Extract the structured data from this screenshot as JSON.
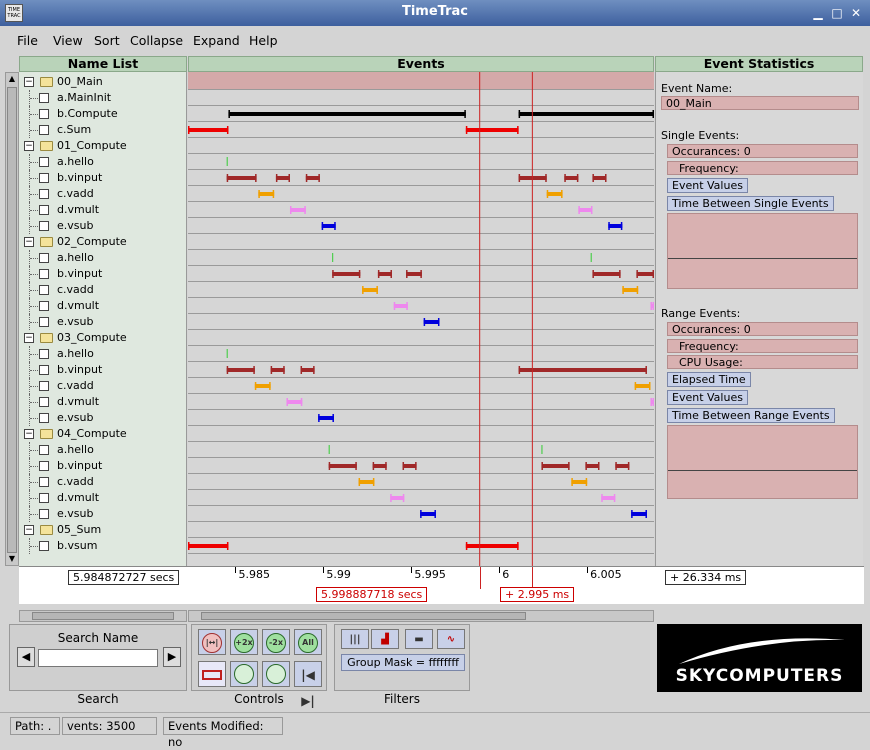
{
  "window": {
    "title": "TimeTrac",
    "logo_text": "TIME TRAC"
  },
  "menu": [
    "File",
    "View",
    "Sort",
    "Collapse",
    "Expand",
    "Help"
  ],
  "headers": {
    "names": "Name List",
    "events": "Events",
    "stats": "Event Statistics"
  },
  "tree": [
    {
      "label": "00_Main",
      "type": "group"
    },
    {
      "label": "a.MainInit",
      "type": "item"
    },
    {
      "label": "b.Compute",
      "type": "item"
    },
    {
      "label": "c.Sum",
      "type": "item"
    },
    {
      "label": "01_Compute",
      "type": "group"
    },
    {
      "label": "a.hello",
      "type": "item"
    },
    {
      "label": "b.vinput",
      "type": "item"
    },
    {
      "label": "c.vadd",
      "type": "item"
    },
    {
      "label": "d.vmult",
      "type": "item"
    },
    {
      "label": "e.vsub",
      "type": "item"
    },
    {
      "label": "02_Compute",
      "type": "group"
    },
    {
      "label": "a.hello",
      "type": "item"
    },
    {
      "label": "b.vinput",
      "type": "item"
    },
    {
      "label": "c.vadd",
      "type": "item"
    },
    {
      "label": "d.vmult",
      "type": "item"
    },
    {
      "label": "e.vsub",
      "type": "item"
    },
    {
      "label": "03_Compute",
      "type": "group"
    },
    {
      "label": "a.hello",
      "type": "item"
    },
    {
      "label": "b.vinput",
      "type": "item"
    },
    {
      "label": "c.vadd",
      "type": "item"
    },
    {
      "label": "d.vmult",
      "type": "item"
    },
    {
      "label": "e.vsub",
      "type": "item"
    },
    {
      "label": "04_Compute",
      "type": "group"
    },
    {
      "label": "a.hello",
      "type": "item"
    },
    {
      "label": "b.vinput",
      "type": "item"
    },
    {
      "label": "c.vadd",
      "type": "item"
    },
    {
      "label": "d.vmult",
      "type": "item"
    },
    {
      "label": "e.vsub",
      "type": "item"
    },
    {
      "label": "05_Sum",
      "type": "group"
    },
    {
      "label": "b.vsum",
      "type": "item"
    }
  ],
  "events": {
    "colors": {
      "compute": "#000000",
      "sum": "#ee0000",
      "hello": "#33cc33",
      "vinput": "#a02828",
      "vadd": "#f0a000",
      "vmult": "#ee88ee",
      "vsub": "#0000dd",
      "selection": "#cc2222",
      "header_band": "#d4a9a9"
    },
    "t_start": 5.9823,
    "t_end": 6.0088,
    "selection": [
      5.998887718,
      6.001882718
    ],
    "rows": [
      [],
      [],
      [
        {
          "s": 5.9846,
          "e": 5.9981,
          "c": "compute"
        },
        {
          "s": 6.0011,
          "e": 6.0088,
          "c": "compute"
        }
      ],
      [
        {
          "s": 5.9823,
          "e": 5.9846,
          "c": "sum"
        },
        {
          "s": 5.9981,
          "e": 6.0011,
          "c": "sum"
        }
      ],
      [],
      [
        {
          "s": 5.9845,
          "e": 5.9846,
          "c": "hello"
        }
      ],
      [
        {
          "s": 5.9845,
          "e": 5.9862,
          "c": "vinput"
        },
        {
          "s": 5.9873,
          "e": 5.9881,
          "c": "vinput"
        },
        {
          "s": 5.989,
          "e": 5.9898,
          "c": "vinput"
        },
        {
          "s": 6.0011,
          "e": 6.0027,
          "c": "vinput"
        },
        {
          "s": 6.0037,
          "e": 6.0045,
          "c": "vinput"
        },
        {
          "s": 6.0053,
          "e": 6.0061,
          "c": "vinput"
        }
      ],
      [
        {
          "s": 5.9863,
          "e": 5.9872,
          "c": "vadd"
        },
        {
          "s": 6.0027,
          "e": 6.0036,
          "c": "vadd"
        }
      ],
      [
        {
          "s": 5.9881,
          "e": 5.989,
          "c": "vmult"
        },
        {
          "s": 6.0045,
          "e": 6.0053,
          "c": "vmult"
        }
      ],
      [
        {
          "s": 5.9899,
          "e": 5.9907,
          "c": "vsub"
        },
        {
          "s": 6.0062,
          "e": 6.007,
          "c": "vsub"
        }
      ],
      [],
      [
        {
          "s": 5.9905,
          "e": 5.9906,
          "c": "hello"
        },
        {
          "s": 6.0052,
          "e": 6.0053,
          "c": "hello"
        }
      ],
      [
        {
          "s": 5.9905,
          "e": 5.9921,
          "c": "vinput"
        },
        {
          "s": 5.9931,
          "e": 5.9939,
          "c": "vinput"
        },
        {
          "s": 5.9947,
          "e": 5.9956,
          "c": "vinput"
        },
        {
          "s": 6.0053,
          "e": 6.0069,
          "c": "vinput"
        },
        {
          "s": 6.0078,
          "e": 6.0088,
          "c": "vinput"
        }
      ],
      [
        {
          "s": 5.9922,
          "e": 5.9931,
          "c": "vadd"
        },
        {
          "s": 6.007,
          "e": 6.0079,
          "c": "vadd"
        }
      ],
      [
        {
          "s": 5.994,
          "e": 5.9948,
          "c": "vmult"
        },
        {
          "s": 6.0086,
          "e": 6.0088,
          "c": "vmult"
        }
      ],
      [
        {
          "s": 5.9957,
          "e": 5.9966,
          "c": "vsub"
        }
      ],
      [],
      [
        {
          "s": 5.9845,
          "e": 5.9846,
          "c": "hello"
        }
      ],
      [
        {
          "s": 5.9845,
          "e": 5.9861,
          "c": "vinput"
        },
        {
          "s": 5.987,
          "e": 5.9878,
          "c": "vinput"
        },
        {
          "s": 5.9887,
          "e": 5.9895,
          "c": "vinput"
        },
        {
          "s": 6.0011,
          "e": 6.0084,
          "c": "vinput"
        }
      ],
      [
        {
          "s": 5.9861,
          "e": 5.987,
          "c": "vadd"
        },
        {
          "s": 6.0077,
          "e": 6.0086,
          "c": "vadd"
        }
      ],
      [
        {
          "s": 5.9879,
          "e": 5.9888,
          "c": "vmult"
        },
        {
          "s": 6.0086,
          "e": 6.0088,
          "c": "vmult"
        }
      ],
      [
        {
          "s": 5.9897,
          "e": 5.9906,
          "c": "vsub"
        }
      ],
      [],
      [
        {
          "s": 5.9903,
          "e": 5.9904,
          "c": "hello"
        },
        {
          "s": 6.0024,
          "e": 6.0025,
          "c": "hello"
        }
      ],
      [
        {
          "s": 5.9903,
          "e": 5.9919,
          "c": "vinput"
        },
        {
          "s": 5.9928,
          "e": 5.9936,
          "c": "vinput"
        },
        {
          "s": 5.9945,
          "e": 5.9953,
          "c": "vinput"
        },
        {
          "s": 6.0024,
          "e": 6.004,
          "c": "vinput"
        },
        {
          "s": 6.0049,
          "e": 6.0057,
          "c": "vinput"
        },
        {
          "s": 6.0066,
          "e": 6.0074,
          "c": "vinput"
        }
      ],
      [
        {
          "s": 5.992,
          "e": 5.9929,
          "c": "vadd"
        },
        {
          "s": 6.0041,
          "e": 6.005,
          "c": "vadd"
        }
      ],
      [
        {
          "s": 5.9938,
          "e": 5.9946,
          "c": "vmult"
        },
        {
          "s": 6.0058,
          "e": 6.0066,
          "c": "vmult"
        }
      ],
      [
        {
          "s": 5.9955,
          "e": 5.9964,
          "c": "vsub"
        },
        {
          "s": 6.0075,
          "e": 6.0084,
          "c": "vsub"
        }
      ],
      [],
      [
        {
          "s": 5.9823,
          "e": 5.9846,
          "c": "sum"
        },
        {
          "s": 5.9981,
          "e": 6.0011,
          "c": "sum"
        }
      ]
    ]
  },
  "stats": {
    "event_name_label": "Event Name:",
    "event_name_value": "00_Main",
    "single_label": "Single Events:",
    "single_occ": "Occurances: 0",
    "single_freq": "Frequency:",
    "single_btn_values": "Event Values",
    "single_btn_between": "Time Between Single Events",
    "range_label": "Range Events:",
    "range_occ": "Occurances: 0",
    "range_freq": "Frequency:",
    "range_cpu": "CPU Usage:",
    "range_btn_elapsed": "Elapsed Time",
    "range_btn_values": "Event Values",
    "range_btn_between": "Time Between Range Events"
  },
  "timeaxis": {
    "start_value": "5.984872727 secs",
    "cursor_value": "5.998887718 secs",
    "delta_value": "+ 2.995 ms",
    "span_value": "+ 26.334 ms",
    "ticks": [
      {
        "label": "5.985",
        "t": 5.985
      },
      {
        "label": "5.99",
        "t": 5.99
      },
      {
        "label": "5.995",
        "t": 5.995
      },
      {
        "label": "6",
        "t": 6.0
      },
      {
        "label": "6.005",
        "t": 6.005
      }
    ]
  },
  "search": {
    "title": "Search Name",
    "value": "",
    "footer": "Search"
  },
  "controls": {
    "footer": "Controls",
    "buttons": [
      "|↔|",
      "+2x",
      "-2x",
      "All"
    ]
  },
  "filters": {
    "footer": "Filters",
    "group_mask": "Group Mask = ffffffff"
  },
  "logo": {
    "text": "SKYCOMPUTERS"
  },
  "statusbar": {
    "path": "Path: .",
    "events": "vents: 3500",
    "modified": "Events Modified: no"
  }
}
